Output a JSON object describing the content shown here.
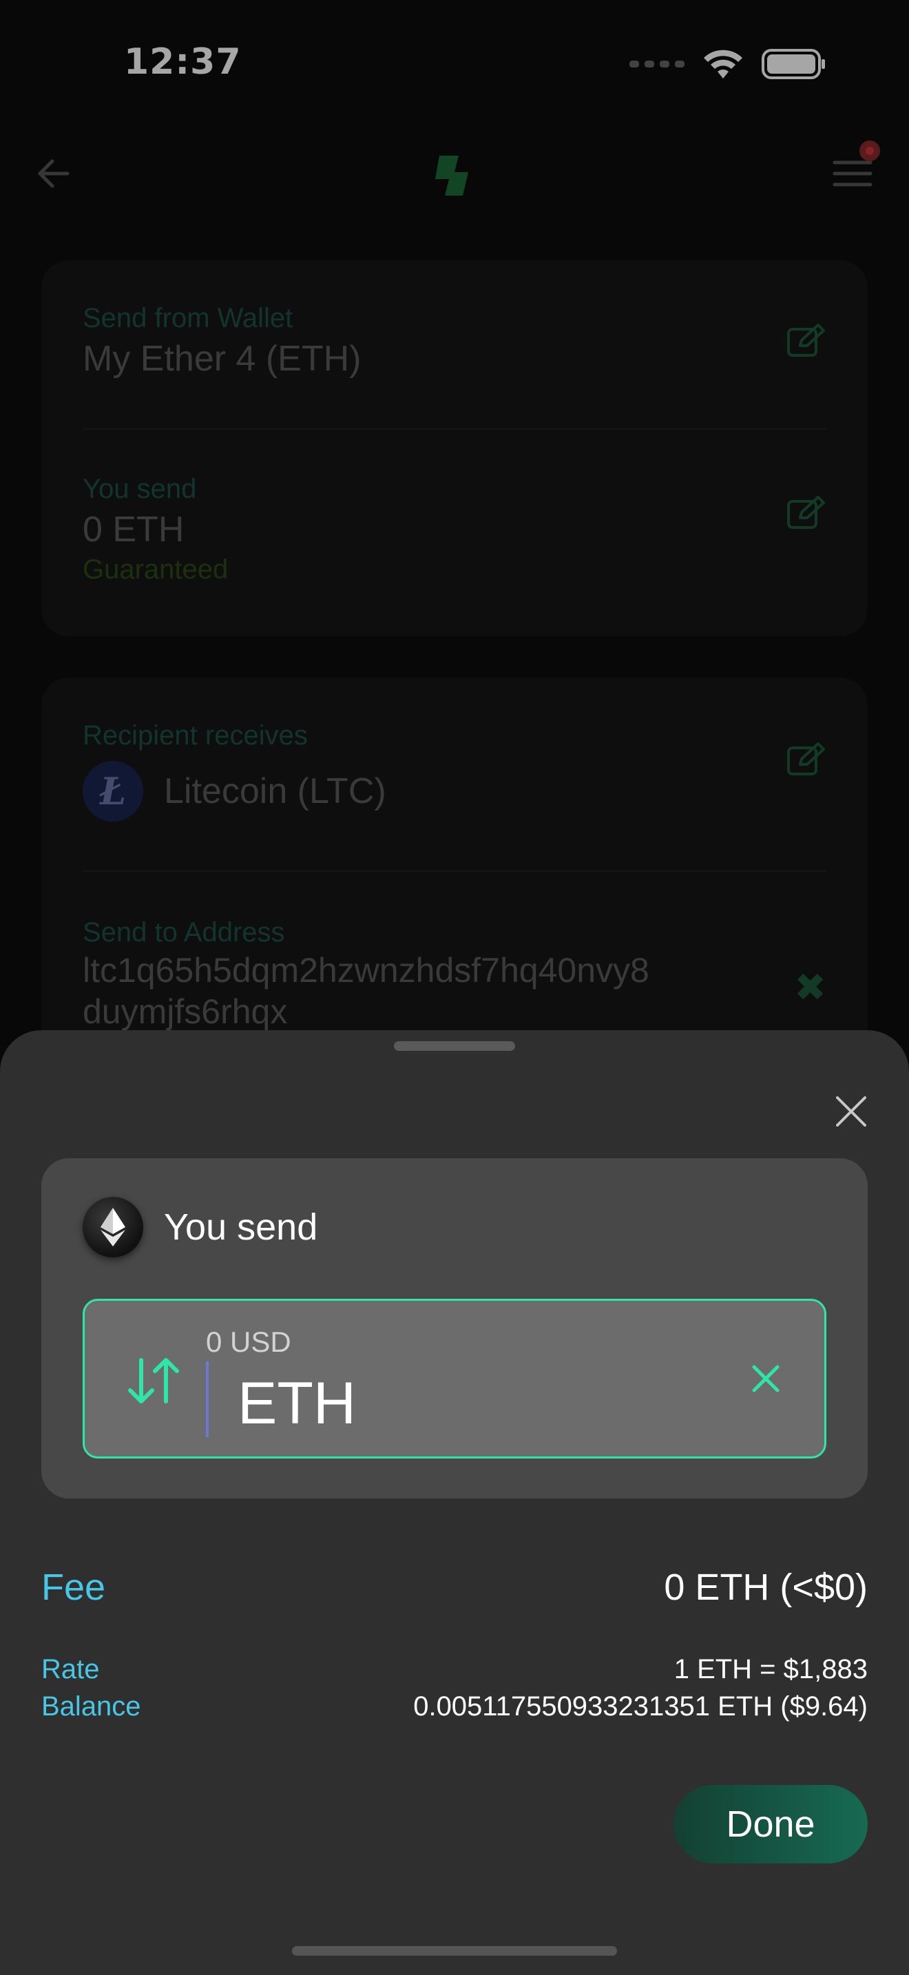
{
  "status": {
    "time": "12:37"
  },
  "form": {
    "send_from_label": "Send from Wallet",
    "send_from_value": "My Ether 4 (ETH)",
    "you_send_label": "You send",
    "you_send_value": "0 ETH",
    "you_send_sub": "Guaranteed",
    "recipient_label": "Recipient receives",
    "recipient_value": "Litecoin (LTC)",
    "recipient_coin_symbol": "Ł",
    "address_label": "Send to Address",
    "address_line1": "ltc1q65h5dqm2hzwnzhdsf7hq40nvy8",
    "address_line2": "duymjfs6rhqx"
  },
  "sheet": {
    "title": "You send",
    "usd_value": "0 USD",
    "currency_input": "ETH",
    "fee_label": "Fee",
    "fee_value": "0 ETH (<$0)",
    "rate_label": "Rate",
    "rate_value": "1 ETH = $1,883",
    "balance_label": "Balance",
    "balance_value": "0.005117550933231351 ETH ($9.64)",
    "done_label": "Done"
  },
  "colors": {
    "accent": "#2ee6a6",
    "info_label": "#47c6e6",
    "done_button": "#176a52"
  }
}
